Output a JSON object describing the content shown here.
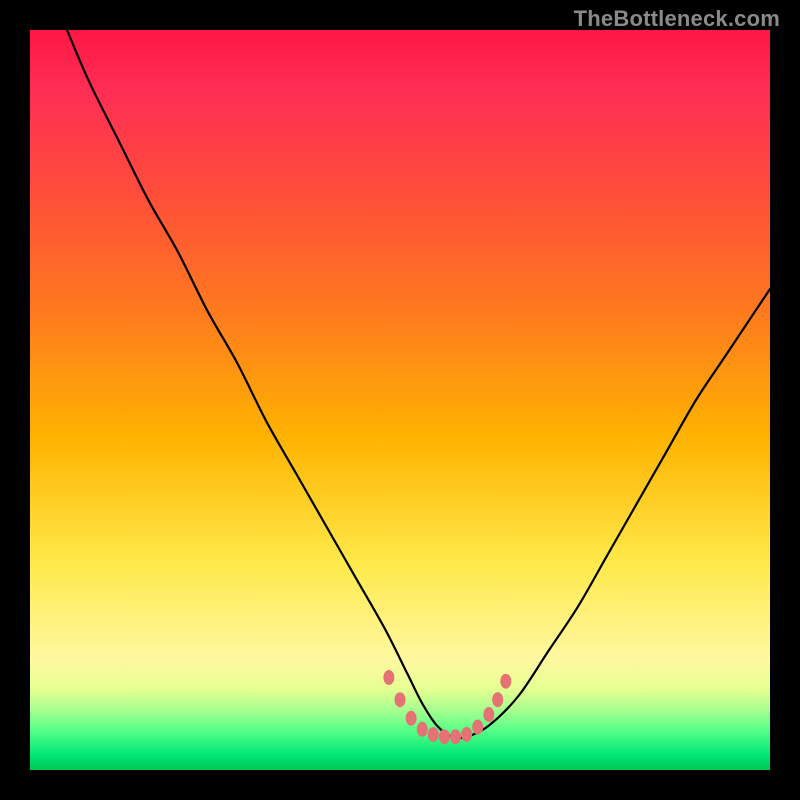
{
  "watermark": {
    "text": "TheBottleneck.com"
  },
  "colors": {
    "frame_bg": "#000000",
    "curve_stroke": "#000000",
    "marker_fill": "#e57373",
    "marker_fill_alt": "#ec8a82"
  },
  "chart_data": {
    "type": "line",
    "title": "",
    "xlabel": "",
    "ylabel": "",
    "xlim": [
      0,
      100
    ],
    "ylim": [
      0,
      100
    ],
    "grid": false,
    "series": [
      {
        "name": "bottleneck-curve",
        "x": [
          5,
          8,
          12,
          16,
          20,
          24,
          28,
          32,
          36,
          40,
          44,
          48,
          51,
          53,
          55,
          57,
          59,
          62,
          66,
          70,
          74,
          78,
          82,
          86,
          90,
          94,
          98,
          100
        ],
        "y": [
          100,
          93,
          85,
          77,
          70,
          62,
          55,
          47,
          40,
          33,
          26,
          19,
          13,
          9,
          6,
          4.5,
          4.5,
          6,
          10,
          16,
          22,
          29,
          36,
          43,
          50,
          56,
          62,
          65
        ]
      }
    ],
    "markers": {
      "name": "bottleneck-markers",
      "points": [
        {
          "x": 48.5,
          "y": 12.5
        },
        {
          "x": 50.0,
          "y": 9.5
        },
        {
          "x": 51.5,
          "y": 7.0
        },
        {
          "x": 53.0,
          "y": 5.5
        },
        {
          "x": 54.5,
          "y": 4.8
        },
        {
          "x": 56.0,
          "y": 4.5
        },
        {
          "x": 57.5,
          "y": 4.5
        },
        {
          "x": 59.0,
          "y": 4.8
        },
        {
          "x": 60.5,
          "y": 5.8
        },
        {
          "x": 62.0,
          "y": 7.5
        },
        {
          "x": 63.2,
          "y": 9.5
        },
        {
          "x": 64.3,
          "y": 12.0
        }
      ]
    },
    "gradient_stops": [
      {
        "pos": 0.0,
        "color": "#ff1744"
      },
      {
        "pos": 0.08,
        "color": "#ff2d55"
      },
      {
        "pos": 0.22,
        "color": "#ff4d3a"
      },
      {
        "pos": 0.38,
        "color": "#ff7a1f"
      },
      {
        "pos": 0.55,
        "color": "#ffb300"
      },
      {
        "pos": 0.72,
        "color": "#ffe94a"
      },
      {
        "pos": 0.85,
        "color": "#fff8a1"
      },
      {
        "pos": 0.89,
        "color": "#e7ff91"
      },
      {
        "pos": 0.92,
        "color": "#a4ff8f"
      },
      {
        "pos": 0.95,
        "color": "#4cff86"
      },
      {
        "pos": 0.98,
        "color": "#00e676"
      },
      {
        "pos": 1.0,
        "color": "#00c853"
      }
    ]
  }
}
